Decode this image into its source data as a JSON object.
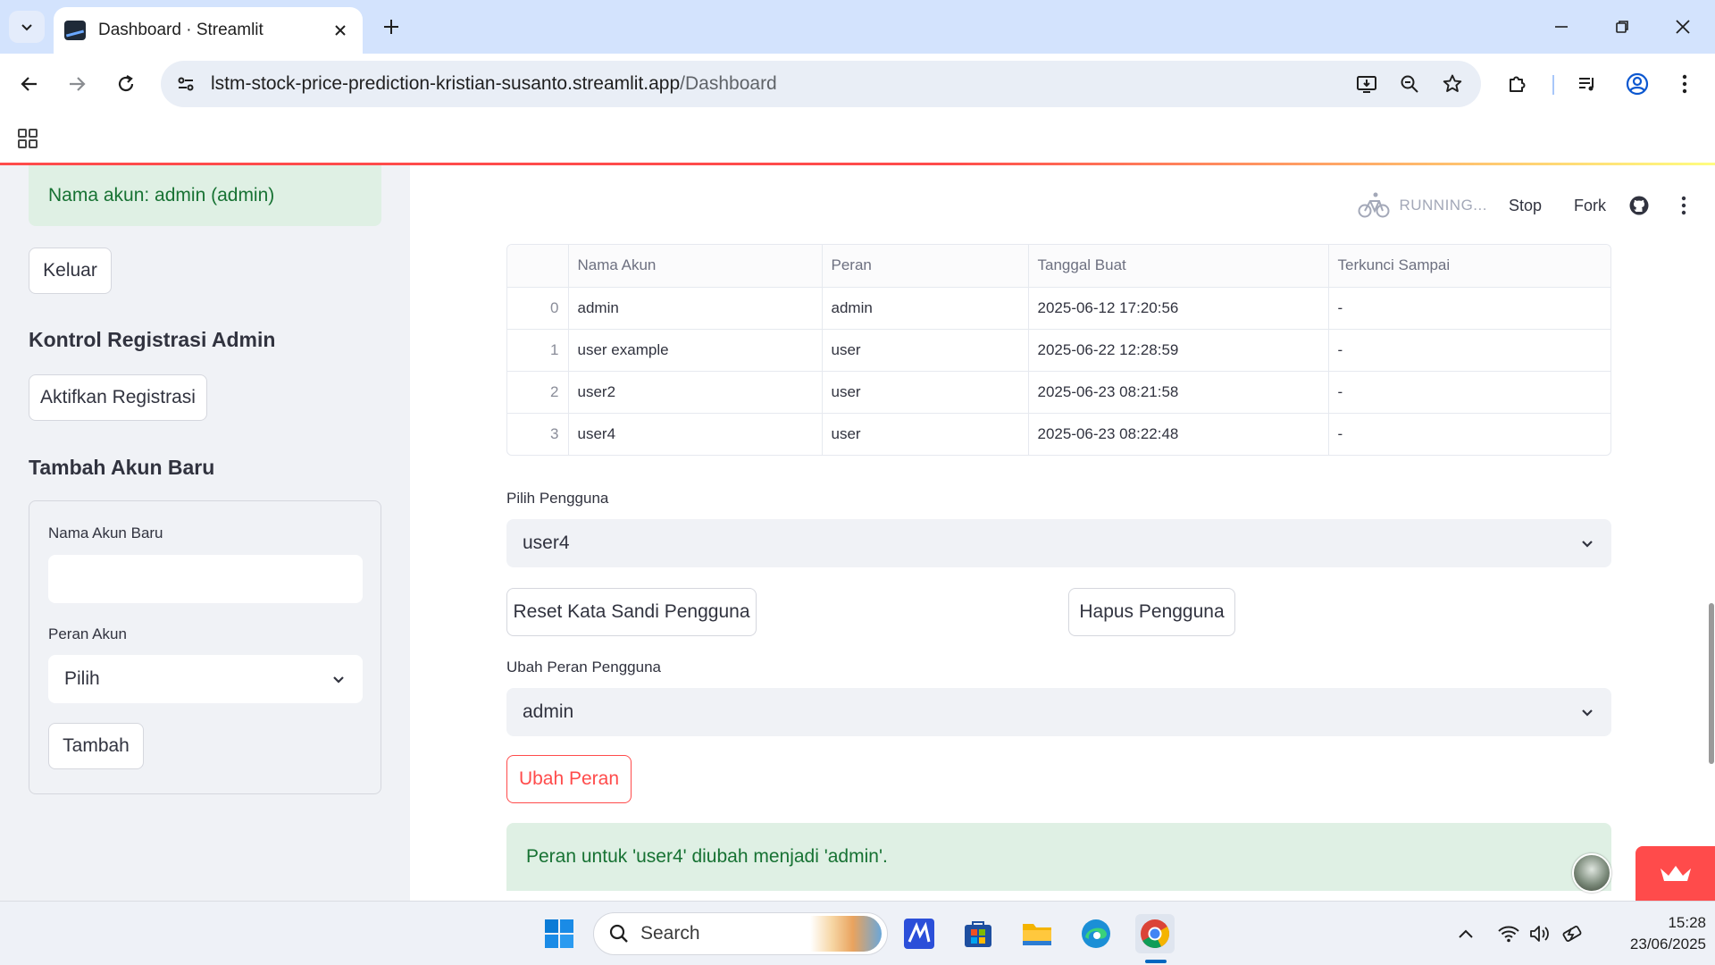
{
  "browser": {
    "tab_title": "Dashboard · Streamlit",
    "url_host": "lstm-stock-price-prediction-kristian-susanto.streamlit.app",
    "url_path": "/Dashboard"
  },
  "sidebar": {
    "account_alert": "Nama akun: admin (admin)",
    "logout_label": "Keluar",
    "registration_heading": "Kontrol Registrasi Admin",
    "registration_button": "Aktifkan Registrasi",
    "new_account_heading": "Tambah Akun Baru",
    "form": {
      "name_label": "Nama Akun Baru",
      "name_value": "",
      "role_label": "Peran Akun",
      "role_value": "Pilih",
      "submit_label": "Tambah"
    }
  },
  "header": {
    "status": "RUNNING...",
    "stop_label": "Stop",
    "fork_label": "Fork"
  },
  "users_table": {
    "columns": [
      "",
      "Nama Akun",
      "Peran",
      "Tanggal Buat",
      "Terkunci Sampai"
    ],
    "rows": [
      {
        "index": "0",
        "name": "admin",
        "role": "admin",
        "created": "2025-06-12 17:20:56",
        "locked": "-"
      },
      {
        "index": "1",
        "name": "user example",
        "role": "user",
        "created": "2025-06-22 12:28:59",
        "locked": "-"
      },
      {
        "index": "2",
        "name": "user2",
        "role": "user",
        "created": "2025-06-23 08:21:58",
        "locked": "-"
      },
      {
        "index": "3",
        "name": "user4",
        "role": "user",
        "created": "2025-06-23 08:22:48",
        "locked": "-"
      }
    ]
  },
  "user_select": {
    "label": "Pilih Pengguna",
    "value": "user4"
  },
  "buttons": {
    "reset_password": "Reset Kata Sandi Pengguna",
    "delete_user": "Hapus Pengguna",
    "change_role": "Ubah Peran"
  },
  "role_select": {
    "label": "Ubah Peran Pengguna",
    "value": "admin"
  },
  "success_message": "Peran untuk 'user4' diubah menjadi 'admin'.",
  "taskbar": {
    "search_placeholder": "Search",
    "time": "15:28",
    "date": "23/06/2025"
  },
  "colors": {
    "accent": "#ff4b4b",
    "success_bg": "#dff0e4",
    "success_text": "#177233",
    "sidebar_bg": "#f0f2f6"
  }
}
